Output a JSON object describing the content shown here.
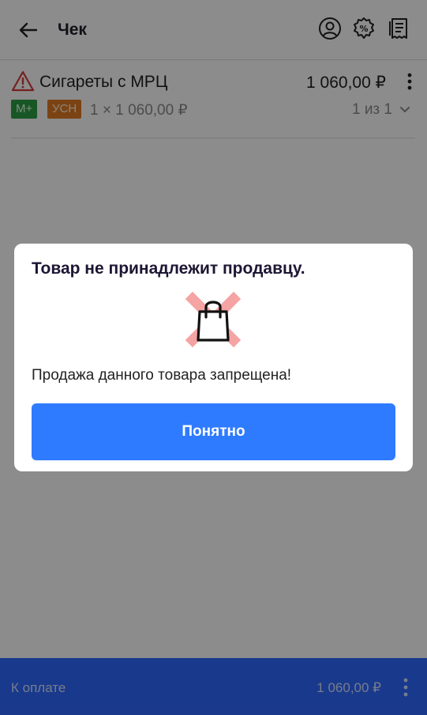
{
  "header": {
    "title": "Чек",
    "icons": [
      "back-arrow-icon",
      "user-circle-icon",
      "discount-percent-icon",
      "receipt-icon"
    ]
  },
  "item": {
    "name": "Сигареты с МРЦ",
    "price": "1 060,00 ₽",
    "badge_mark": "М+",
    "badge_tax": "УСН",
    "qty_line": "1 × 1 060,00 ₽",
    "position": "1 из 1",
    "icons": [
      "warning-triangle-icon",
      "more-vertical-icon",
      "chevron-down-icon"
    ]
  },
  "footer": {
    "label": "К оплате",
    "amount": "1 060,00 ₽"
  },
  "dialog": {
    "title": "Товар не принадлежит продавцу.",
    "message": "Продажа данного товара запрещена!",
    "button_label": "Понятно",
    "icon": "shopping-bag-forbidden-icon"
  },
  "colors": {
    "accent": "#2f7bff",
    "badge_mark": "#2d9d46",
    "badge_tax": "#e07b24",
    "warning": "#d83b3b",
    "cross": "#f5a3a3"
  }
}
